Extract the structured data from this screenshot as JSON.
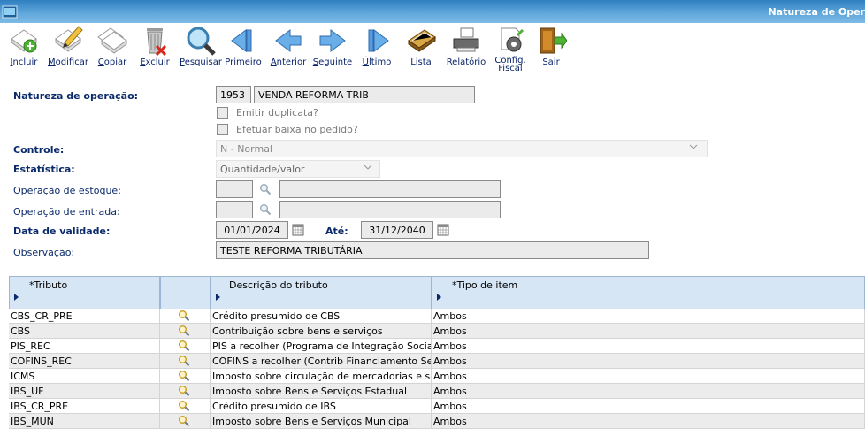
{
  "window": {
    "title": "Natureza de Oper"
  },
  "toolbar": {
    "items": [
      {
        "label": "Incluir",
        "icon": "add-icon"
      },
      {
        "label": "Modificar",
        "icon": "edit-icon"
      },
      {
        "label": "Copiar",
        "icon": "copy-icon"
      },
      {
        "label": "Excluir",
        "icon": "delete-icon"
      },
      {
        "label": "Pesquisar",
        "icon": "search-icon"
      },
      {
        "label": "Primeiro",
        "icon": "first-icon"
      },
      {
        "label": "Anterior",
        "icon": "previous-icon"
      },
      {
        "label": "Seguinte",
        "icon": "next-icon"
      },
      {
        "label": "Último",
        "icon": "last-icon"
      },
      {
        "label": "Lista",
        "icon": "list-icon"
      },
      {
        "label": "Relatório",
        "icon": "report-icon"
      },
      {
        "label": "Config. Fiscal",
        "icon": "config-fiscal-icon"
      },
      {
        "label": "Sair",
        "icon": "exit-icon"
      }
    ]
  },
  "form": {
    "natureza_label": "Natureza de operação:",
    "natureza_code": "1953",
    "natureza_desc": "VENDA REFORMA TRIB",
    "emitir_duplicata": "Emitir duplicata?",
    "efetuar_baixa": "Efetuar baixa no pedido?",
    "controle_label": "Controle:",
    "controle_value": "N - Normal",
    "estatistica_label": "Estatística:",
    "estatistica_value": "Quantidade/valor",
    "op_estoque_label": "Operação de estoque:",
    "op_entrada_label": "Operação de entrada:",
    "data_validade_label": "Data de validade:",
    "data_de": "01/01/2024",
    "ate_label": "Até:",
    "data_ate": "31/12/2040",
    "observacao_label": "Observação:",
    "observacao_value": "TESTE REFORMA TRIBUTÁRIA"
  },
  "grid": {
    "headers": {
      "tributo": "*Tributo",
      "descricao": "Descrição do tributo",
      "tipo": "*Tipo de item"
    },
    "rows": [
      {
        "tributo": "CBS_CR_PRE",
        "descricao": "Crédito presumido de CBS",
        "tipo": "Ambos"
      },
      {
        "tributo": "CBS",
        "descricao": "Contribuição sobre bens e serviços",
        "tipo": "Ambos"
      },
      {
        "tributo": "PIS_REC",
        "descricao": "PIS a recolher (Programa de Integração Social)",
        "tipo": "Ambos"
      },
      {
        "tributo": "COFINS_REC",
        "descricao": "COFINS a recolher (Contrib Financiamento Seguridade",
        "tipo": "Ambos"
      },
      {
        "tributo": "ICMS",
        "descricao": "Imposto sobre circulação de mercadorias e serviços",
        "tipo": "Ambos"
      },
      {
        "tributo": "IBS_UF",
        "descricao": "Imposto sobre Bens e Serviços Estadual",
        "tipo": "Ambos"
      },
      {
        "tributo": "IBS_CR_PRE",
        "descricao": "Crédito presumido de IBS",
        "tipo": "Ambos"
      },
      {
        "tributo": "IBS_MUN",
        "descricao": "Imposto sobre Bens e Serviços Municipal",
        "tipo": "Ambos"
      }
    ]
  },
  "colors": {
    "label_blue": "#0b2a6b",
    "header_bg": "#d6e6f5",
    "row_alt": "#ececec"
  }
}
